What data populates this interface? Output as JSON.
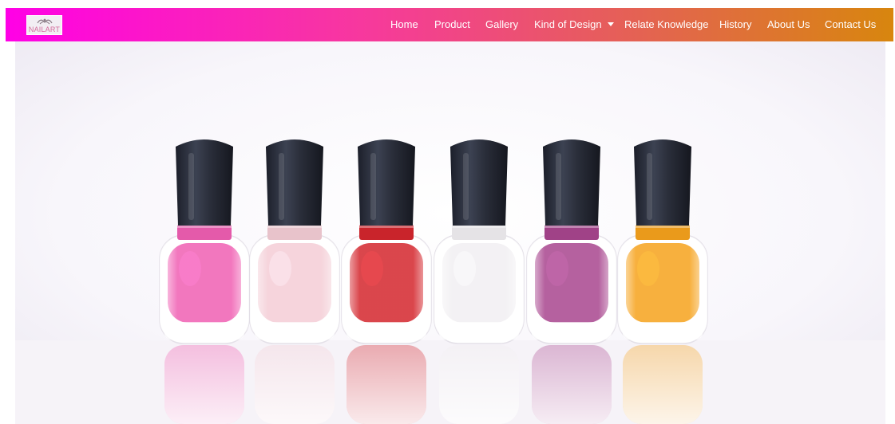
{
  "brand": {
    "logo_text": "NAILART",
    "icon": "ornament-logo-icon"
  },
  "nav": {
    "home": "Home",
    "product": "Product",
    "gallery": "Gallery",
    "kind_of_design": "Kind of Design",
    "relate_knowledge": "Relate Knowledge",
    "history": "History",
    "about_us": "About Us",
    "contact_us": "Contact Us"
  },
  "hero": {
    "image": "nail-polish-bottles-photo",
    "polish_colors": [
      "#f05fb3",
      "#f4cdd6",
      "#d4262d",
      "#f1eff2",
      "#a8458e",
      "#f6a21c"
    ]
  },
  "colors": {
    "nav_gradient_start": "#ff00e6",
    "nav_gradient_end": "#d8860e"
  }
}
